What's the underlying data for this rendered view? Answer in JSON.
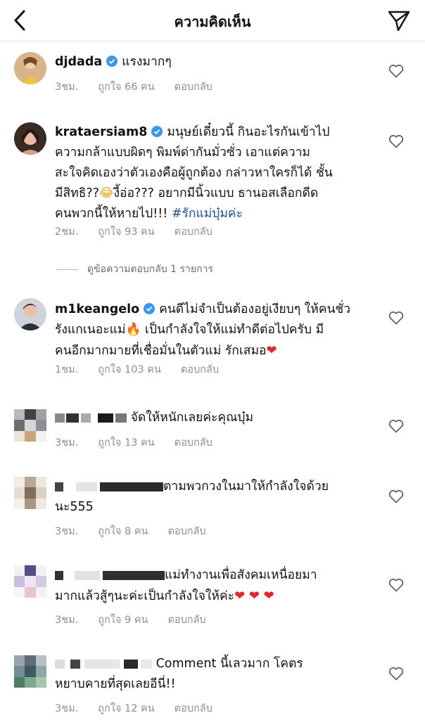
{
  "header": {
    "title": "ความคิดเห็น"
  },
  "colors": {
    "link_blue": "#1b4f9c",
    "meta_gray": "#8e8e8e",
    "verified_blue": "#3897f0",
    "heart_red": "#e0262b"
  },
  "comments": [
    {
      "username": "djdada",
      "verified": true,
      "text": "แรงมากๆ",
      "time": "3ชม.",
      "likes": "ถูกใจ 66 คน",
      "reply": "ตอบกลับ"
    },
    {
      "username": "krataersiam8",
      "verified": true,
      "text_lines": [
        "มนุษย์เดี๋ยวนี้ กินอะไรกันเข้าไป",
        "ความกล้าแบบผิดๆ พิมพ์ด่ากันมั่วซั่ว เอาแต่ความ",
        "สะใจคิดเองว่าตัวเองคือผู้ถูกต้อง กล่าวหาใครก็ได้ ชั้น",
        "มีสิทธิ??",
        "งี้อ่อ??? อยากมีนิ้วแบบ ธานอสเลือกดีด",
        "คนพวกนี้ให้หายไป!!! "
      ],
      "emoji": "😂",
      "hashtag": "#รักแม่บุ๋มค่ะ",
      "time": "2ชม.",
      "likes": "ถูกใจ 93 คน",
      "reply": "ตอบกลับ",
      "view_replies": "ดูข้อความตอบกลับ 1 รายการ"
    },
    {
      "username": "m1keangelo",
      "verified": true,
      "text_lines": [
        "คนดีไม่จำเป็นต้องอยู่เงียบๆ ให้คนชั่ว",
        "รังแกเนอะแม่",
        " เป็นกำลังใจให้แม่ทำดีต่อไปครับ มี",
        "คนอีกมากมายที่เชื่อมั่นในตัวแม่ รักเสมอ"
      ],
      "emoji_fire": "🔥",
      "emoji_heart": "❤",
      "time": "1ชม.",
      "likes": "ถูกใจ 103 คน",
      "reply": "ตอบกลับ"
    },
    {
      "text": "จัดให้หนักเลยค่ะคุณบุ๋ม",
      "time": "3ชม.",
      "likes": "ถูกใจ 13 คน",
      "reply": "ตอบกลับ"
    },
    {
      "text_lines": [
        "ตามพวกวงในมาให้กำลังใจด้วย",
        "นะ555"
      ],
      "time": "3ชม.",
      "likes": "ถูกใจ 8 คน",
      "reply": "ตอบกลับ"
    },
    {
      "text_lines": [
        "แม่ทำงานเพื่อสังคมเหนื่อยมา",
        "มากแล้วสู้ๆนะค่ะเป็นกำลังใจให้ค่ะ"
      ],
      "emoji_hearts": "❤ ❤ ❤",
      "time": "3ชม.",
      "likes": "ถูกใจ 9 คน",
      "reply": "ตอบกลับ"
    },
    {
      "text_lines": [
        "Comment นี้เลวมาก โคตร",
        "หยาบคายที่สุดเลยอีนี่!!"
      ],
      "time": "3ชม.",
      "likes": "ถูกใจ 12 คน",
      "reply": "ตอบกลับ"
    }
  ]
}
